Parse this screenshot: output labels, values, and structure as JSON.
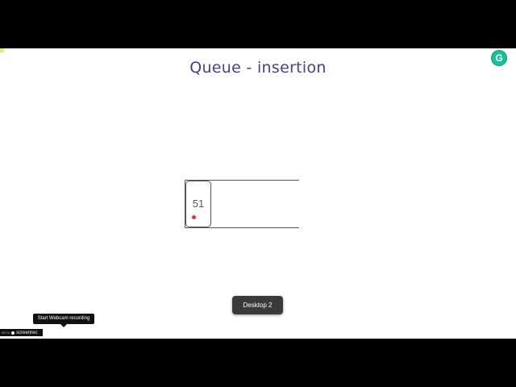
{
  "slide": {
    "title": "Queue - insertion"
  },
  "queue": {
    "cells": [
      {
        "value": "51"
      }
    ]
  },
  "overlays": {
    "desktop_toast": "Desktop 2",
    "webcam_tooltip": "Start Webcam recording",
    "screenrec_beta": "BETA",
    "screenrec_label": "screenrec"
  },
  "icons": {
    "grammarly": "grammarly-icon",
    "cursor": "cursor-dot-icon",
    "screenrec_record": "record-icon"
  },
  "colors": {
    "title": "#4b3c8c",
    "grammarly": "#15c39a",
    "cursor": "#e0303a"
  }
}
